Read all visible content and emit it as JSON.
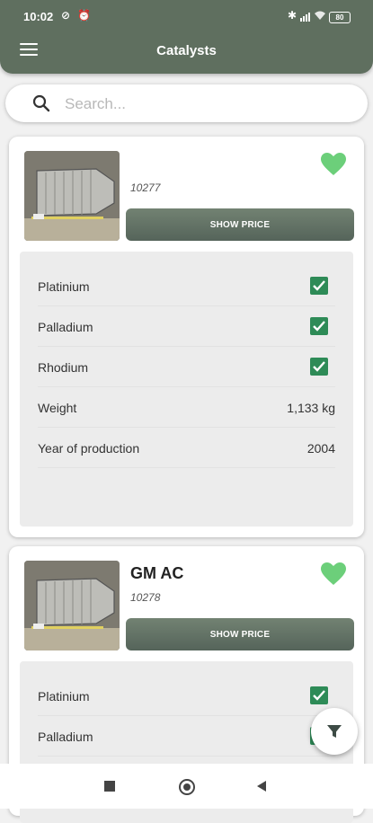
{
  "status_bar": {
    "time": "10:02",
    "battery": "80",
    "icons": [
      "no-disturb-icon",
      "alarm-icon",
      "bluetooth-icon",
      "signal-icon",
      "wifi-icon",
      "battery-icon"
    ]
  },
  "app_bar": {
    "title": "Catalysts",
    "menu_icon": "hamburger-menu-icon",
    "color": "#5f6f5f"
  },
  "search": {
    "placeholder": "Search...",
    "value": "",
    "icon": "search-icon"
  },
  "cards": [
    {
      "name": "",
      "code": "10277",
      "show_price_label": "SHOW PRICE",
      "favorite_icon": "heart-icon",
      "details": [
        {
          "label": "Platinium",
          "type": "check",
          "checked": true
        },
        {
          "label": "Palladium",
          "type": "check",
          "checked": true
        },
        {
          "label": "Rhodium",
          "type": "check",
          "checked": true
        },
        {
          "label": "Weight",
          "type": "text",
          "value": "1,133 kg"
        },
        {
          "label": "Year of production",
          "type": "text",
          "value": "2004"
        }
      ]
    },
    {
      "name": "GM AC",
      "code": "10278",
      "show_price_label": "SHOW PRICE",
      "favorite_icon": "heart-icon",
      "details": [
        {
          "label": "Platinium",
          "type": "check",
          "checked": true
        },
        {
          "label": "Palladium",
          "type": "check",
          "checked": true
        }
      ]
    }
  ],
  "fab": {
    "icon": "filter-icon"
  },
  "nav_bar": {
    "icons": [
      "recent-apps-icon",
      "home-icon",
      "back-icon"
    ]
  },
  "colors": {
    "accent": "#5f6f5f",
    "check": "#2e8b57",
    "heart": "#6ccf7a"
  }
}
